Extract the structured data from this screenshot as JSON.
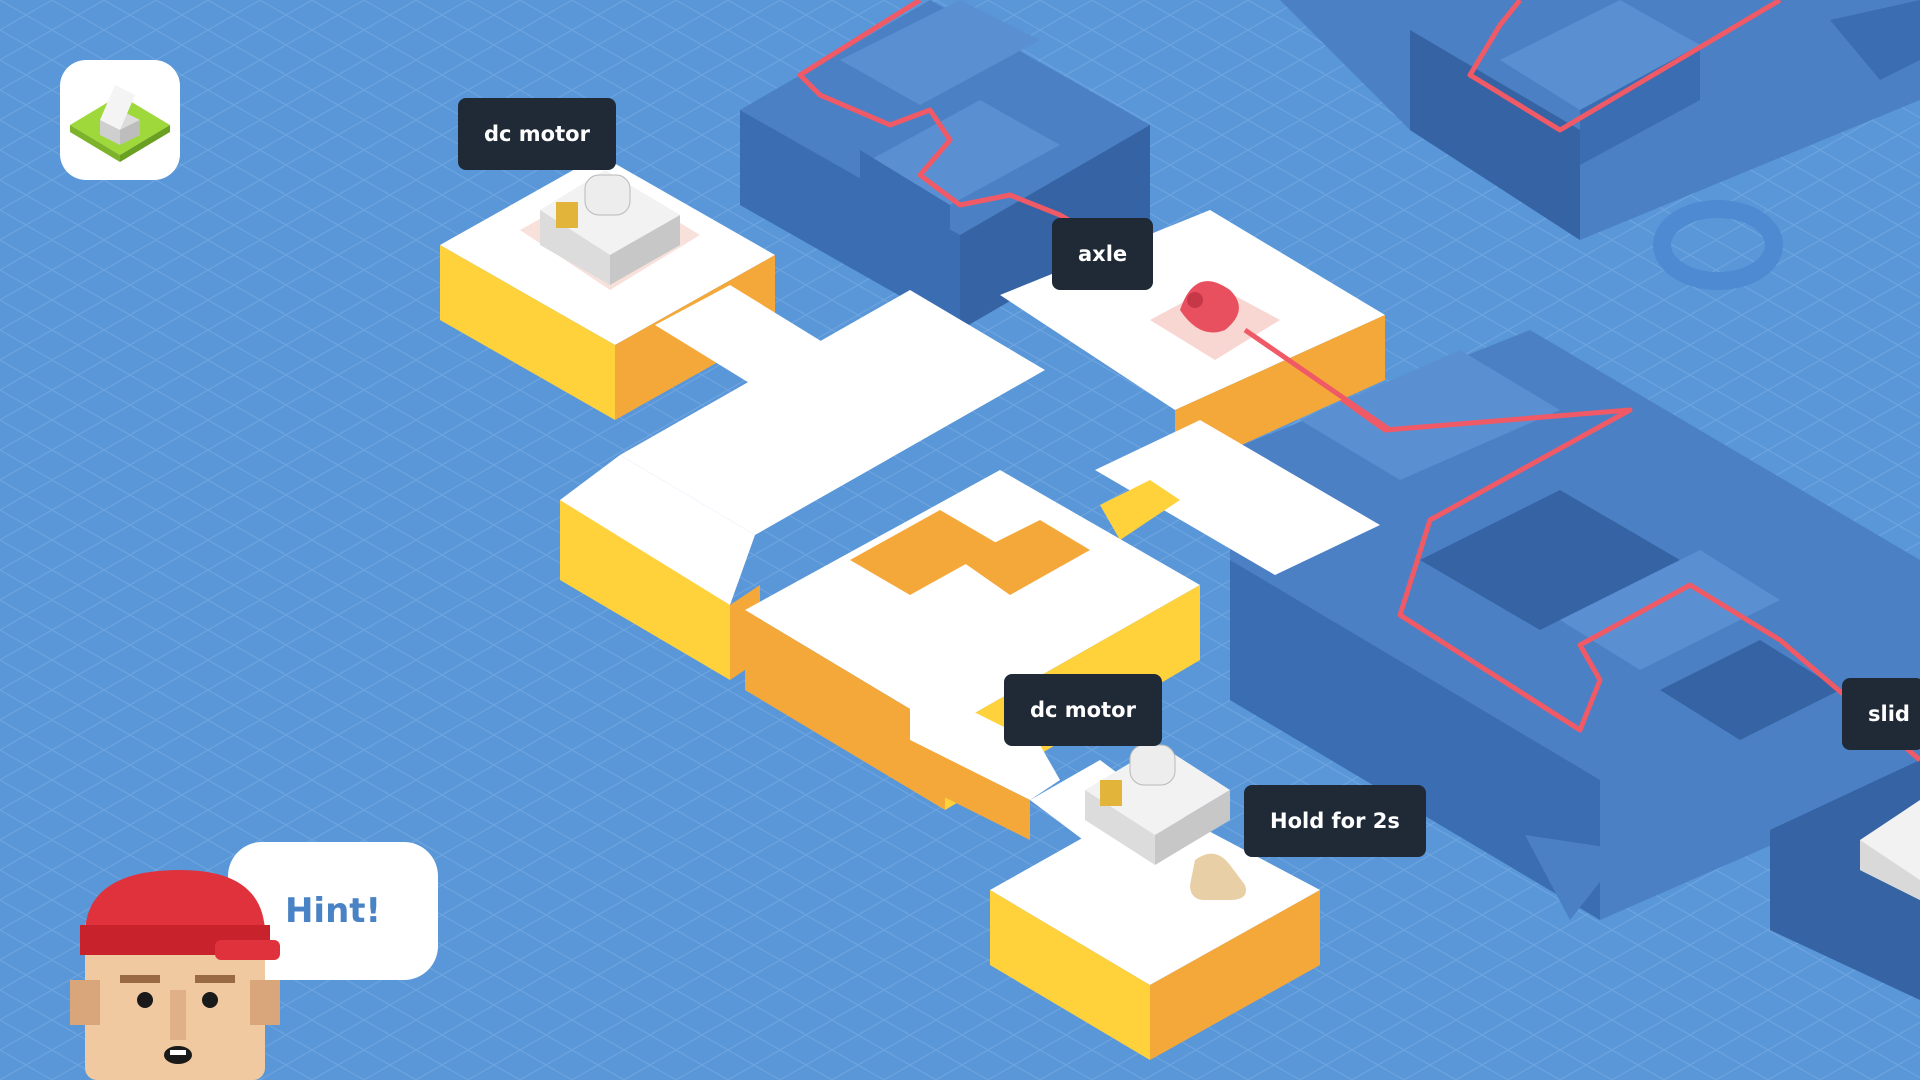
{
  "labels": {
    "motor_top": "dc motor",
    "axle": "axle",
    "motor_bottom": "dc motor",
    "hold": "Hold for 2s",
    "slider_partial": "slid"
  },
  "hint": {
    "label": "Hint!"
  },
  "icons": {
    "home": "home-level-icon",
    "character": "character-avatar-icon",
    "tap_hand": "tap-hand-icon",
    "ring": "ring-marker-icon",
    "arrow": "play-arrow-icon"
  },
  "colors": {
    "background": "#5a97d8",
    "grid_line": "#7fb0e6",
    "platform_top": "#ffffff",
    "platform_side_light": "#ffd23c",
    "platform_side_dark": "#f5a83a",
    "blueprint_top": "#4b80c4",
    "blueprint_side": "#3563a3",
    "wire": "#ef5a66",
    "label_bg": "#1f2a36",
    "hint_text": "#4a82c6"
  }
}
